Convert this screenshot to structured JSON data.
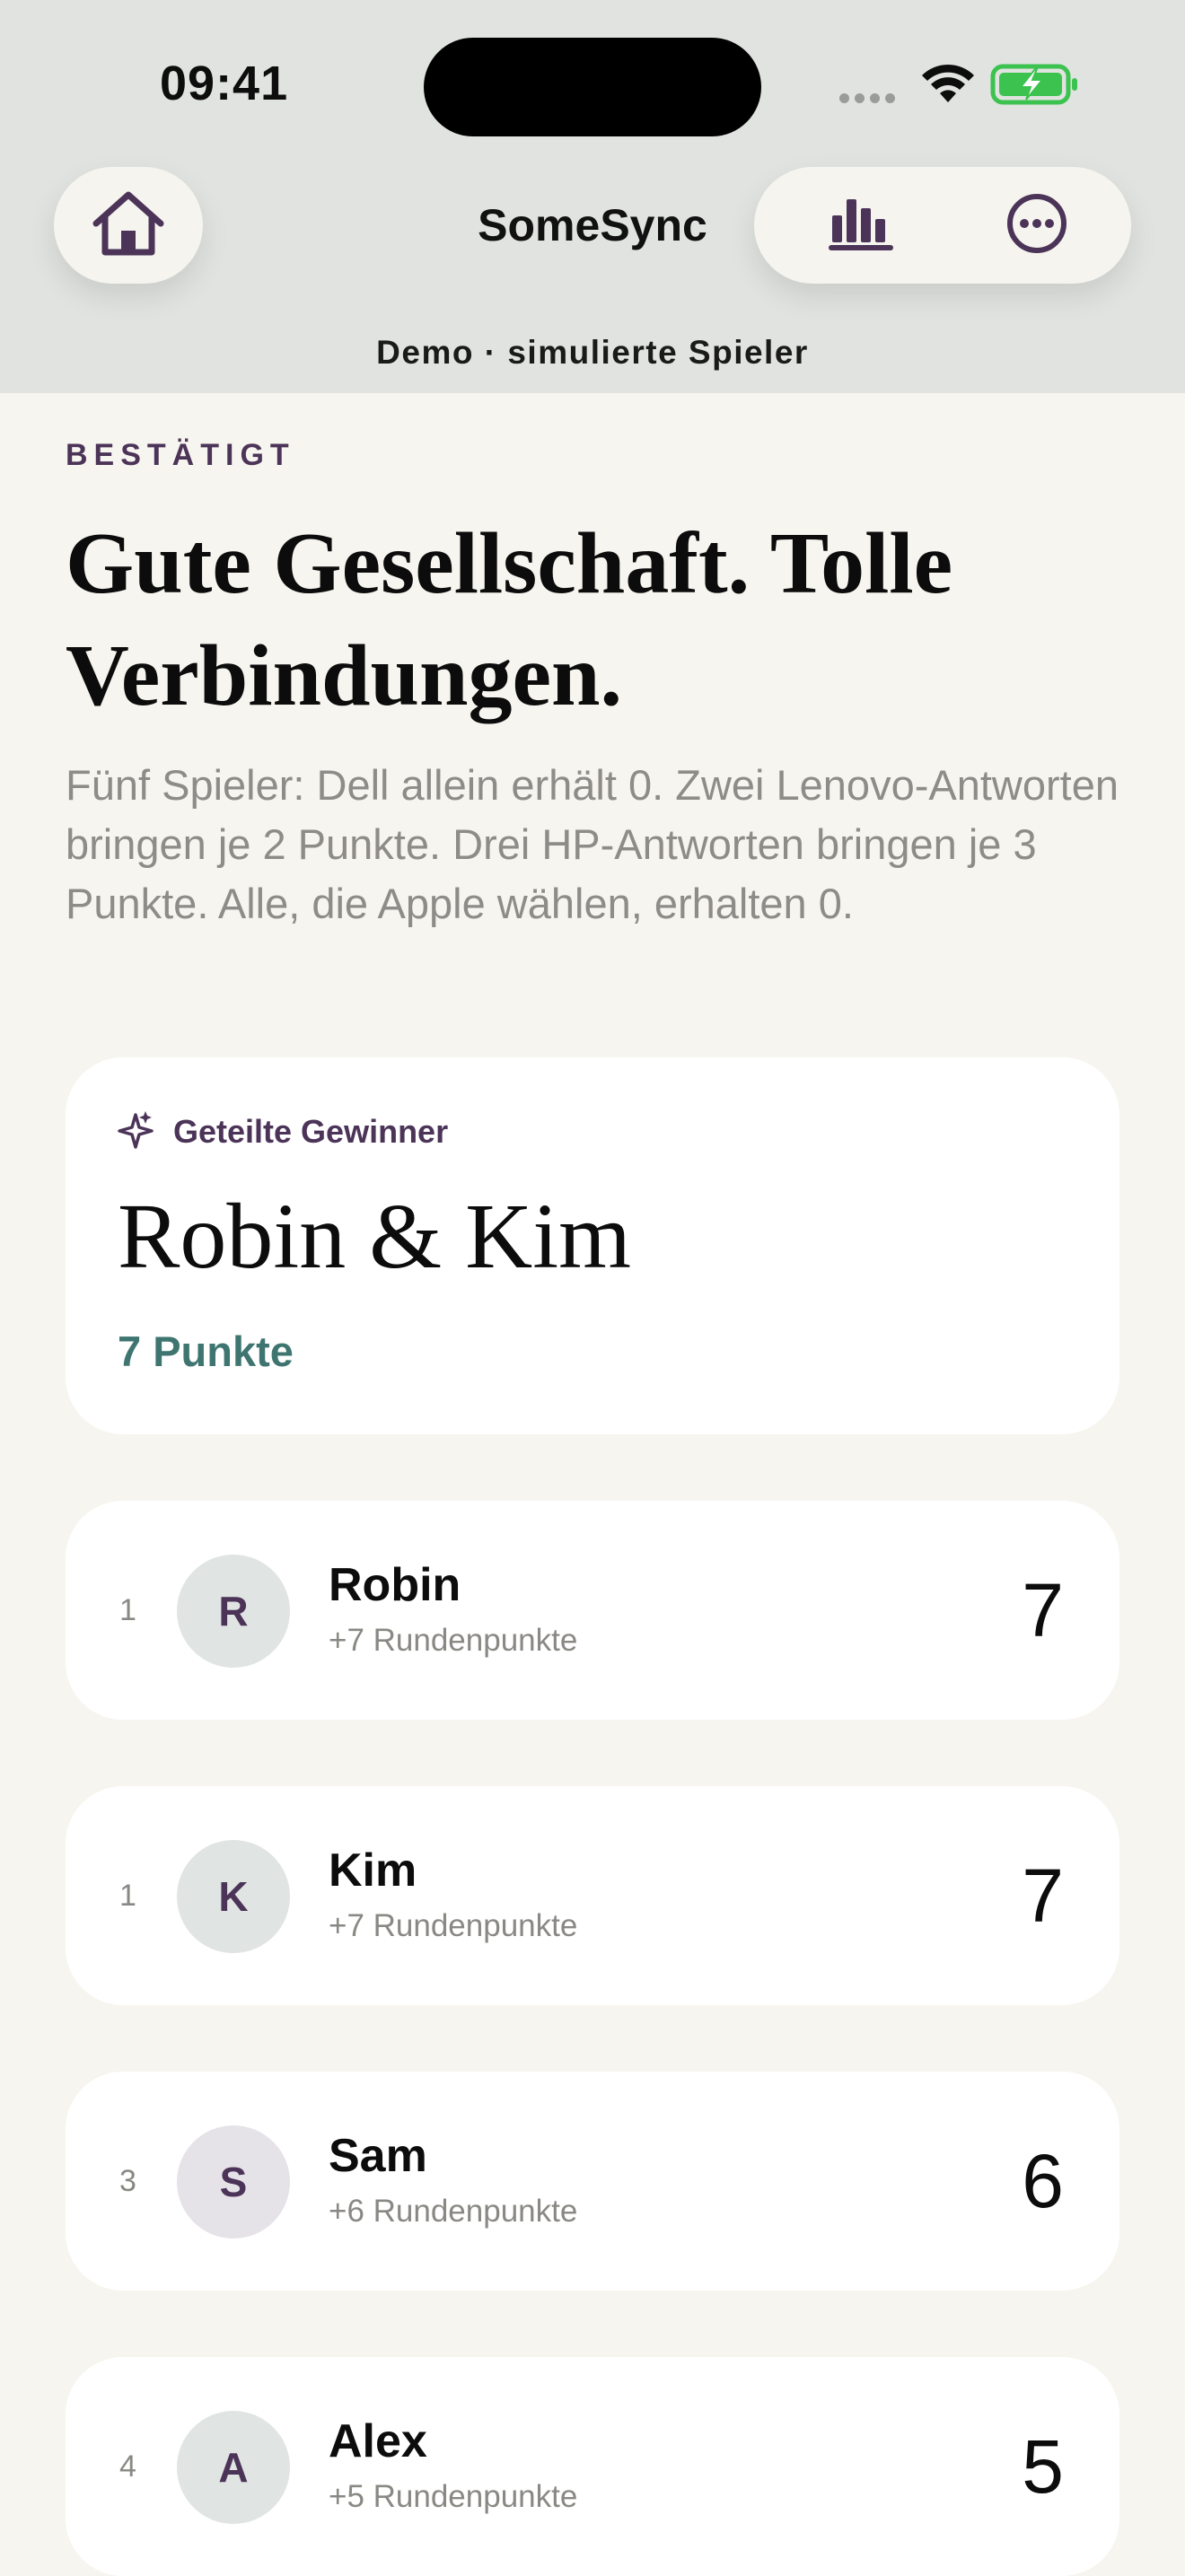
{
  "status_bar": {
    "time": "09:41"
  },
  "header": {
    "title": "SomeSync",
    "mode_label": "Demo · simulierte Spieler",
    "home_icon": "home-icon",
    "stats_icon": "bar-chart-icon",
    "more_icon": "ellipsis-circle-icon"
  },
  "result": {
    "eyebrow": "BESTÄTIGT",
    "headline": "Gute Gesellschaft. Tolle Verbindungen.",
    "description": "Fünf Spieler: Dell allein erhält 0. Zwei Lenovo-Antworten bringen je 2 Punkte. Drei HP-Antworten bringen je 3 Punkte. Alle, die Apple wählen, erhalten 0."
  },
  "winner": {
    "label": "Geteilte Gewinner",
    "names": "Robin & Kim",
    "points": "7 Punkte",
    "icon": "sparkles-icon"
  },
  "players": [
    {
      "rank": "1",
      "initial": "R",
      "name": "Robin",
      "sub": "+7 Rundenpunkte",
      "score": "7"
    },
    {
      "rank": "1",
      "initial": "K",
      "name": "Kim",
      "sub": "+7 Rundenpunkte",
      "score": "7"
    },
    {
      "rank": "3",
      "initial": "S",
      "name": "Sam",
      "sub": "+6 Rundenpunkte",
      "score": "6"
    },
    {
      "rank": "4",
      "initial": "A",
      "name": "Alex",
      "sub": "+5 Rundenpunkte",
      "score": "5"
    }
  ],
  "colors": {
    "accent_purple": "#4b3458",
    "points_teal": "#3f7570",
    "background": "#f7f5ef",
    "header_background": "#e0e3df",
    "battery_green": "#3cc24f"
  }
}
